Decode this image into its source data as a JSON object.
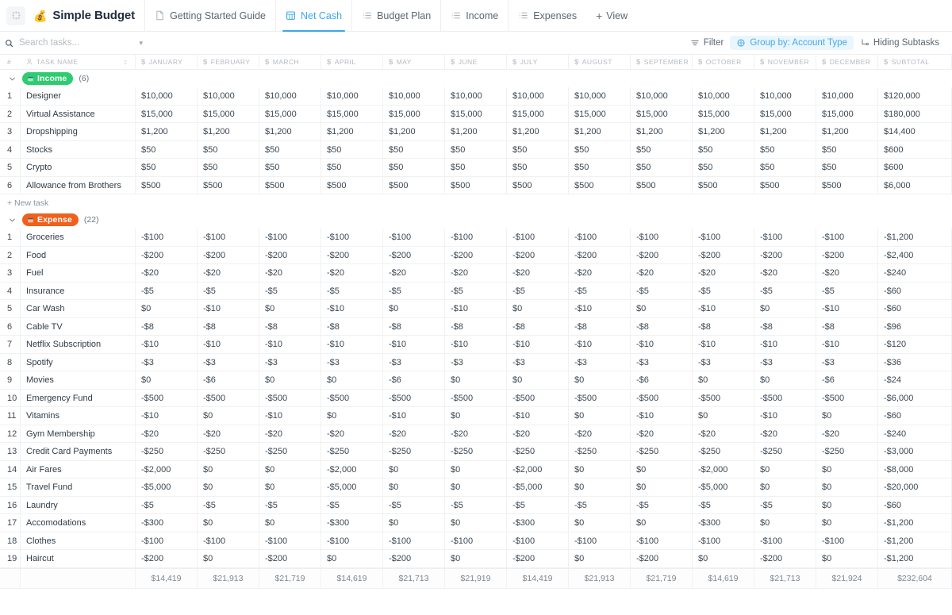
{
  "header": {
    "app_switcher_icon": "dots-grid-icon",
    "brand_emoji": "money-bag-emoji",
    "brand_title": "Simple Budget",
    "tabs": [
      {
        "label": "Getting Started Guide",
        "icon": "doc-icon",
        "active": false
      },
      {
        "label": "Net Cash",
        "icon": "table-icon",
        "active": true
      },
      {
        "label": "Budget Plan",
        "icon": "list-icon",
        "active": false
      },
      {
        "label": "Income",
        "icon": "list-icon",
        "active": false
      },
      {
        "label": "Expenses",
        "icon": "list-icon",
        "active": false
      }
    ],
    "add_view_label": "View",
    "add_view_icon": "plus-icon"
  },
  "toolbar": {
    "search_placeholder": "Search tasks...",
    "search_value": "",
    "search_icon": "search-icon",
    "search_chevron_icon": "chevron-down-icon",
    "filter_label": "Filter",
    "filter_icon": "filter-icon",
    "group_by_label": "Group by: Account Type",
    "group_by_icon": "group-icon",
    "hiding_subtasks_label": "Hiding Subtasks",
    "hiding_subtasks_icon": "subtask-icon",
    "accent_color": "#44a8e8",
    "accent_bg": "#eaf6fe"
  },
  "columns": [
    {
      "key": "num",
      "label": "#",
      "icon": ""
    },
    {
      "key": "name",
      "label": "TASK NAME",
      "icon": "person-icon"
    },
    {
      "key": "january",
      "label": "JANUARY",
      "icon": "dollar-icon"
    },
    {
      "key": "february",
      "label": "FEBRUARY",
      "icon": "dollar-icon"
    },
    {
      "key": "march",
      "label": "MARCH",
      "icon": "dollar-icon"
    },
    {
      "key": "april",
      "label": "APRIL",
      "icon": "dollar-icon"
    },
    {
      "key": "may",
      "label": "MAY",
      "icon": "dollar-icon"
    },
    {
      "key": "june",
      "label": "JUNE",
      "icon": "dollar-icon"
    },
    {
      "key": "july",
      "label": "JULY",
      "icon": "dollar-icon"
    },
    {
      "key": "august",
      "label": "AUGUST",
      "icon": "dollar-icon"
    },
    {
      "key": "september",
      "label": "SEPTEMBER",
      "icon": "dollar-icon"
    },
    {
      "key": "october",
      "label": "OCTOBER",
      "icon": "dollar-icon"
    },
    {
      "key": "november",
      "label": "NOVEMBER",
      "icon": "dollar-icon"
    },
    {
      "key": "december",
      "label": "DECEMBER",
      "icon": "dollar-icon"
    },
    {
      "key": "subtotal",
      "label": "SUBTOTAL",
      "icon": "dollar-icon"
    }
  ],
  "sort_icon": "sort-icon",
  "groups": [
    {
      "id": "income",
      "badge_label": "Income",
      "badge_color": "#2ecc71",
      "badge_icon": "account-icon",
      "count_label": "(6)",
      "caret_icon": "chevron-down-icon",
      "new_task_label": "+ New task",
      "show_new_task": true,
      "rows": [
        {
          "n": "1",
          "name": "Designer",
          "v": [
            "$10,000",
            "$10,000",
            "$10,000",
            "$10,000",
            "$10,000",
            "$10,000",
            "$10,000",
            "$10,000",
            "$10,000",
            "$10,000",
            "$10,000",
            "$10,000"
          ],
          "subtotal": "$120,000"
        },
        {
          "n": "2",
          "name": "Virtual Assistance",
          "v": [
            "$15,000",
            "$15,000",
            "$15,000",
            "$15,000",
            "$15,000",
            "$15,000",
            "$15,000",
            "$15,000",
            "$15,000",
            "$15,000",
            "$15,000",
            "$15,000"
          ],
          "subtotal": "$180,000"
        },
        {
          "n": "3",
          "name": "Dropshipping",
          "v": [
            "$1,200",
            "$1,200",
            "$1,200",
            "$1,200",
            "$1,200",
            "$1,200",
            "$1,200",
            "$1,200",
            "$1,200",
            "$1,200",
            "$1,200",
            "$1,200"
          ],
          "subtotal": "$14,400"
        },
        {
          "n": "4",
          "name": "Stocks",
          "v": [
            "$50",
            "$50",
            "$50",
            "$50",
            "$50",
            "$50",
            "$50",
            "$50",
            "$50",
            "$50",
            "$50",
            "$50"
          ],
          "subtotal": "$600"
        },
        {
          "n": "5",
          "name": "Crypto",
          "v": [
            "$50",
            "$50",
            "$50",
            "$50",
            "$50",
            "$50",
            "$50",
            "$50",
            "$50",
            "$50",
            "$50",
            "$50"
          ],
          "subtotal": "$600"
        },
        {
          "n": "6",
          "name": "Allowance from Brothers",
          "v": [
            "$500",
            "$500",
            "$500",
            "$500",
            "$500",
            "$500",
            "$500",
            "$500",
            "$500",
            "$500",
            "$500",
            "$500"
          ],
          "subtotal": "$6,000"
        }
      ]
    },
    {
      "id": "expense",
      "badge_label": "Expense",
      "badge_color": "#f0601c",
      "badge_icon": "account-icon",
      "count_label": "(22)",
      "caret_icon": "chevron-down-icon",
      "new_task_label": "+ New task",
      "show_new_task": false,
      "rows": [
        {
          "n": "1",
          "name": "Groceries",
          "v": [
            "-$100",
            "-$100",
            "-$100",
            "-$100",
            "-$100",
            "-$100",
            "-$100",
            "-$100",
            "-$100",
            "-$100",
            "-$100",
            "-$100"
          ],
          "subtotal": "-$1,200"
        },
        {
          "n": "2",
          "name": "Food",
          "v": [
            "-$200",
            "-$200",
            "-$200",
            "-$200",
            "-$200",
            "-$200",
            "-$200",
            "-$200",
            "-$200",
            "-$200",
            "-$200",
            "-$200"
          ],
          "subtotal": "-$2,400"
        },
        {
          "n": "3",
          "name": "Fuel",
          "v": [
            "-$20",
            "-$20",
            "-$20",
            "-$20",
            "-$20",
            "-$20",
            "-$20",
            "-$20",
            "-$20",
            "-$20",
            "-$20",
            "-$20"
          ],
          "subtotal": "-$240"
        },
        {
          "n": "4",
          "name": "Insurance",
          "v": [
            "-$5",
            "-$5",
            "-$5",
            "-$5",
            "-$5",
            "-$5",
            "-$5",
            "-$5",
            "-$5",
            "-$5",
            "-$5",
            "-$5"
          ],
          "subtotal": "-$60"
        },
        {
          "n": "5",
          "name": "Car Wash",
          "v": [
            "$0",
            "-$10",
            "$0",
            "-$10",
            "$0",
            "-$10",
            "$0",
            "-$10",
            "$0",
            "-$10",
            "$0",
            "-$10"
          ],
          "subtotal": "-$60"
        },
        {
          "n": "6",
          "name": "Cable TV",
          "v": [
            "-$8",
            "-$8",
            "-$8",
            "-$8",
            "-$8",
            "-$8",
            "-$8",
            "-$8",
            "-$8",
            "-$8",
            "-$8",
            "-$8"
          ],
          "subtotal": "-$96"
        },
        {
          "n": "7",
          "name": "Netflix Subscription",
          "v": [
            "-$10",
            "-$10",
            "-$10",
            "-$10",
            "-$10",
            "-$10",
            "-$10",
            "-$10",
            "-$10",
            "-$10",
            "-$10",
            "-$10"
          ],
          "subtotal": "-$120"
        },
        {
          "n": "8",
          "name": "Spotify",
          "v": [
            "-$3",
            "-$3",
            "-$3",
            "-$3",
            "-$3",
            "-$3",
            "-$3",
            "-$3",
            "-$3",
            "-$3",
            "-$3",
            "-$3"
          ],
          "subtotal": "-$36"
        },
        {
          "n": "9",
          "name": "Movies",
          "v": [
            "$0",
            "-$6",
            "$0",
            "$0",
            "-$6",
            "$0",
            "$0",
            "$0",
            "-$6",
            "$0",
            "$0",
            "-$6"
          ],
          "subtotal": "-$24"
        },
        {
          "n": "10",
          "name": "Emergency Fund",
          "v": [
            "-$500",
            "-$500",
            "-$500",
            "-$500",
            "-$500",
            "-$500",
            "-$500",
            "-$500",
            "-$500",
            "-$500",
            "-$500",
            "-$500"
          ],
          "subtotal": "-$6,000"
        },
        {
          "n": "11",
          "name": "Vitamins",
          "v": [
            "-$10",
            "$0",
            "-$10",
            "$0",
            "-$10",
            "$0",
            "-$10",
            "$0",
            "-$10",
            "$0",
            "-$10",
            "$0"
          ],
          "subtotal": "-$60"
        },
        {
          "n": "12",
          "name": "Gym Membership",
          "v": [
            "-$20",
            "-$20",
            "-$20",
            "-$20",
            "-$20",
            "-$20",
            "-$20",
            "-$20",
            "-$20",
            "-$20",
            "-$20",
            "-$20"
          ],
          "subtotal": "-$240"
        },
        {
          "n": "13",
          "name": "Credit Card Payments",
          "v": [
            "-$250",
            "-$250",
            "-$250",
            "-$250",
            "-$250",
            "-$250",
            "-$250",
            "-$250",
            "-$250",
            "-$250",
            "-$250",
            "-$250"
          ],
          "subtotal": "-$3,000"
        },
        {
          "n": "14",
          "name": "Air Fares",
          "v": [
            "-$2,000",
            "$0",
            "$0",
            "-$2,000",
            "$0",
            "$0",
            "-$2,000",
            "$0",
            "$0",
            "-$2,000",
            "$0",
            "$0"
          ],
          "subtotal": "-$8,000"
        },
        {
          "n": "15",
          "name": "Travel Fund",
          "v": [
            "-$5,000",
            "$0",
            "$0",
            "-$5,000",
            "$0",
            "$0",
            "-$5,000",
            "$0",
            "$0",
            "-$5,000",
            "$0",
            "$0"
          ],
          "subtotal": "-$20,000"
        },
        {
          "n": "16",
          "name": "Laundry",
          "v": [
            "-$5",
            "-$5",
            "-$5",
            "-$5",
            "-$5",
            "-$5",
            "-$5",
            "-$5",
            "-$5",
            "-$5",
            "-$5",
            "$0"
          ],
          "subtotal": "-$60"
        },
        {
          "n": "17",
          "name": "Accomodations",
          "v": [
            "-$300",
            "$0",
            "$0",
            "-$300",
            "$0",
            "$0",
            "-$300",
            "$0",
            "$0",
            "-$300",
            "$0",
            "$0"
          ],
          "subtotal": "-$1,200"
        },
        {
          "n": "18",
          "name": "Clothes",
          "v": [
            "-$100",
            "-$100",
            "-$100",
            "-$100",
            "-$100",
            "-$100",
            "-$100",
            "-$100",
            "-$100",
            "-$100",
            "-$100",
            "-$100"
          ],
          "subtotal": "-$1,200"
        },
        {
          "n": "19",
          "name": "Haircut",
          "v": [
            "-$200",
            "$0",
            "-$200",
            "$0",
            "-$200",
            "$0",
            "-$200",
            "$0",
            "-$200",
            "$0",
            "-$200",
            "$0"
          ],
          "subtotal": "-$1,200"
        }
      ]
    }
  ],
  "totals": {
    "values": [
      "$14,419",
      "$21,913",
      "$21,719",
      "$14,619",
      "$21,713",
      "$21,919",
      "$14,419",
      "$21,913",
      "$21,719",
      "$14,619",
      "$21,713",
      "$21,924"
    ],
    "subtotal": "$232,604"
  }
}
